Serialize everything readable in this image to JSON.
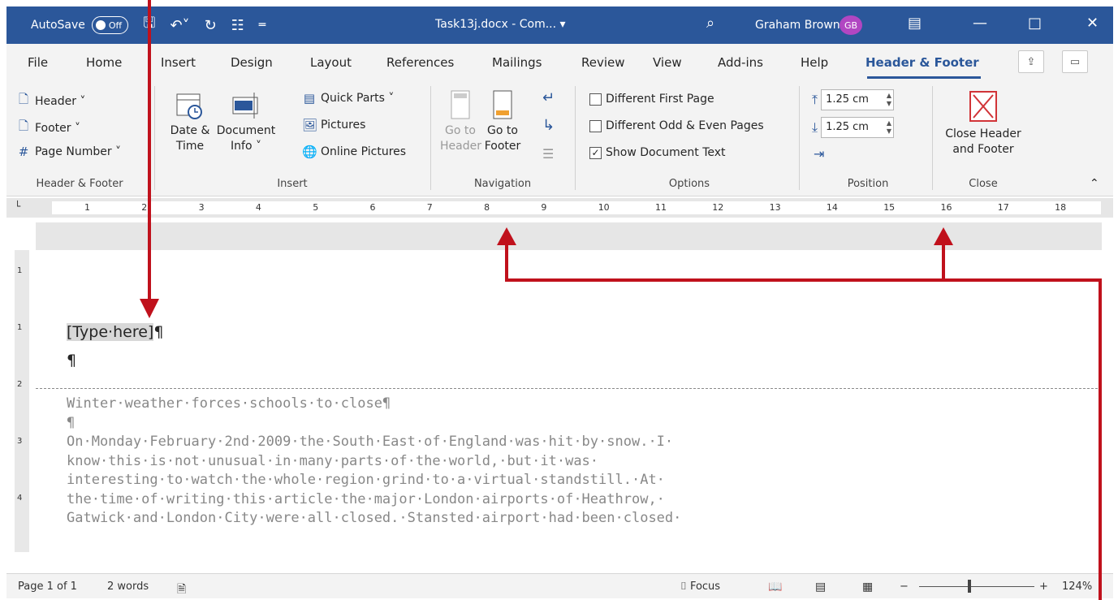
{
  "titlebar": {
    "autosave_label": "AutoSave",
    "autosave_state": "Off",
    "doc_title": "Task13j.docx - Com... ▾",
    "user_name": "Graham Brown",
    "user_initials": "GB",
    "accent_color": "#2b579a",
    "avatar_color": "#b146c2"
  },
  "tabs": [
    "File",
    "Home",
    "Insert",
    "Design",
    "Layout",
    "References",
    "Mailings",
    "Review",
    "View",
    "Add-ins",
    "Help",
    "Header & Footer"
  ],
  "active_tab": "Header & Footer",
  "ribbon": {
    "header_footer": {
      "header": "Header ˅",
      "footer": "Footer ˅",
      "page_number": "Page Number ˅",
      "group": "Header & Footer"
    },
    "insert": {
      "date_time_1": "Date &",
      "date_time_2": "Time",
      "doc_info_1": "Document",
      "doc_info_2": "Info ˅",
      "quick_parts": "Quick Parts ˅",
      "pictures": "Pictures",
      "online_pictures": "Online Pictures",
      "group": "Insert"
    },
    "navigation": {
      "goto_header_1": "Go to",
      "goto_header_2": "Header",
      "goto_footer_1": "Go to",
      "goto_footer_2": "Footer",
      "group": "Navigation"
    },
    "options": {
      "different_first": "Different First Page",
      "different_odd_even": "Different Odd & Even Pages",
      "show_doc_text": "Show Document Text",
      "show_doc_text_checked": true,
      "group": "Options"
    },
    "position": {
      "header_from_top": "1.25 cm",
      "footer_from_bottom": "1.25 cm",
      "group": "Position"
    },
    "close": {
      "label_1": "Close Header",
      "label_2": "and Footer",
      "group": "Close"
    }
  },
  "ruler": {
    "marks": [
      "1",
      "2",
      "3",
      "4",
      "5",
      "6",
      "7",
      "8",
      "9",
      "10",
      "11",
      "12",
      "13",
      "14",
      "15",
      "16",
      "17",
      "18"
    ]
  },
  "document": {
    "header_placeholder": "[Type·here]",
    "pilcrow": "¶",
    "body_lines": [
      "Winter·weather·forces·schools·to·close¶",
      "¶",
      "On·Monday·February·2nd·2009·the·South·East·of·England·was·hit·by·snow.·I·",
      "know·this·is·not·unusual·in·many·parts·of·the·world,·but·it·was·",
      "interesting·to·watch·the·whole·region·grind·to·a·virtual·standstill.·At·",
      "the·time·of·writing·this·article·the·major·London·airports·of·Heathrow,·",
      "Gatwick·and·London·City·were·all·closed.·Stansted·airport·had·been·closed·"
    ]
  },
  "statusbar": {
    "page": "Page 1 of 1",
    "words": "2 words",
    "focus": "Focus",
    "zoom": "124%"
  },
  "annotation_color": "#c0111c"
}
